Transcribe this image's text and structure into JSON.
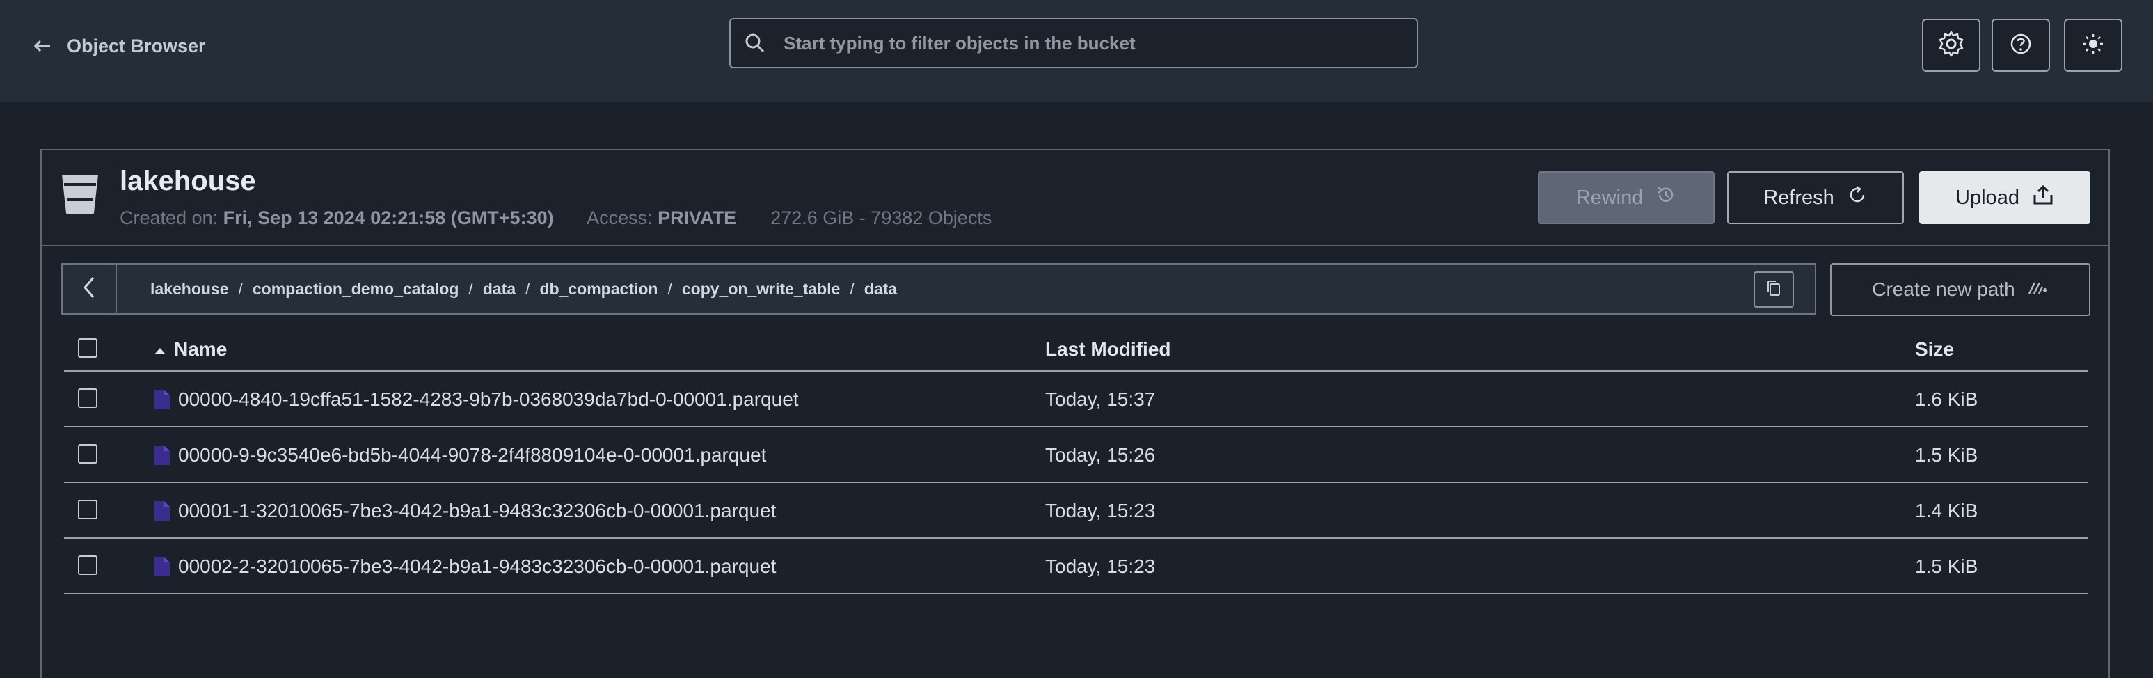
{
  "topbar": {
    "back_label": "Object Browser",
    "search_placeholder": "Start typing to filter objects in the bucket",
    "buttons": [
      "settings",
      "help",
      "theme"
    ]
  },
  "bucket": {
    "name": "lakehouse",
    "created_label": "Created on:",
    "created_value": "Fri, Sep 13 2024 02:21:58 (GMT+5:30)",
    "access_label": "Access:",
    "access_value": "PRIVATE",
    "usage": "272.6 GiB - 79382 Objects"
  },
  "actions": {
    "rewind": "Rewind",
    "refresh": "Refresh",
    "upload": "Upload",
    "create_path": "Create new path"
  },
  "breadcrumb": [
    "lakehouse",
    "compaction_demo_catalog",
    "data",
    "db_compaction",
    "copy_on_write_table",
    "data"
  ],
  "breadcrumb_separator": "/",
  "table": {
    "columns": {
      "name": "Name",
      "modified": "Last Modified",
      "size": "Size"
    },
    "rows": [
      {
        "name": "00000-4840-19cffa51-1582-4283-9b7b-0368039da7bd-0-00001.parquet",
        "modified": "Today, 15:37",
        "size": "1.6 KiB"
      },
      {
        "name": "00000-9-9c3540e6-bd5b-4044-9078-2f4f8809104e-0-00001.parquet",
        "modified": "Today, 15:26",
        "size": "1.5 KiB"
      },
      {
        "name": "00001-1-32010065-7be3-4042-b9a1-9483c32306cb-0-00001.parquet",
        "modified": "Today, 15:23",
        "size": "1.4 KiB"
      },
      {
        "name": "00002-2-32010065-7be3-4042-b9a1-9483c32306cb-0-00001.parquet",
        "modified": "Today, 15:23",
        "size": "1.5 KiB"
      }
    ]
  },
  "colors": {
    "topbar": "#252d39",
    "background": "#1b212b",
    "file_icon": "#3b2d8f"
  }
}
